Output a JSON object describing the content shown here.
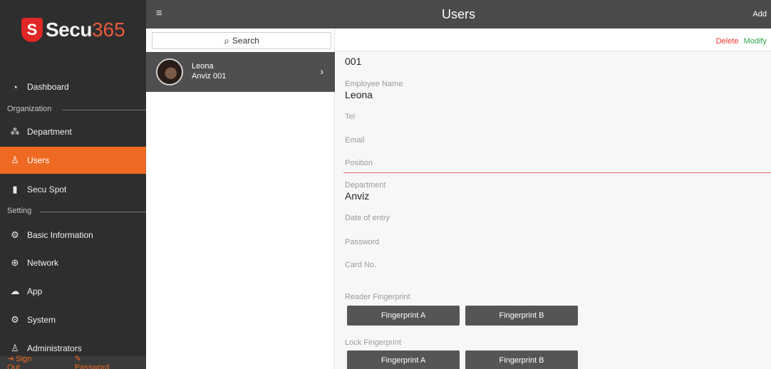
{
  "app": {
    "logo_letter": "S",
    "logo_name": "Secu",
    "logo_number": "365"
  },
  "sidebar": {
    "dashboard": "Dashboard",
    "section_org": "Organization",
    "department": "Department",
    "users": "Users",
    "secu_spot": "Secu Spot",
    "section_setting": "Setting",
    "basic_information": "Basic Information",
    "network": "Network",
    "app": "App",
    "system": "System",
    "administrators": "Administrators",
    "sign_out": "Sign Out",
    "password": "Password"
  },
  "header": {
    "menu_icon": "≡",
    "title": "Users",
    "add": "Add"
  },
  "list": {
    "search_label": "Search",
    "items": [
      {
        "name": "Leona",
        "sub": "Anviz 001"
      }
    ]
  },
  "detail": {
    "actions": {
      "delete": "Delete",
      "modify": "Modify"
    },
    "employee_id_value": "001",
    "employee_name_label": "Employee Name",
    "employee_name_value": "Leona",
    "tel_label": "Tel",
    "email_label": "Email",
    "position_label": "Position",
    "department_label": "Department",
    "department_value": "Anviz",
    "date_of_entry_label": "Date of entry",
    "password_label": "Password",
    "card_no_label": "Card No.",
    "reader_fp_label": "Reader Fingerprint",
    "lock_fp_label": "Lock Fingerprint",
    "fingerprint_a": "Fingerprint A",
    "fingerprint_b": "Fingerprint B"
  },
  "colors": {
    "accent": "#ee6a22",
    "sidebar_bg": "#2e2e2e",
    "topbar_bg": "#4a4a4a",
    "delete": "#e33333",
    "modify": "#2ea84a"
  }
}
